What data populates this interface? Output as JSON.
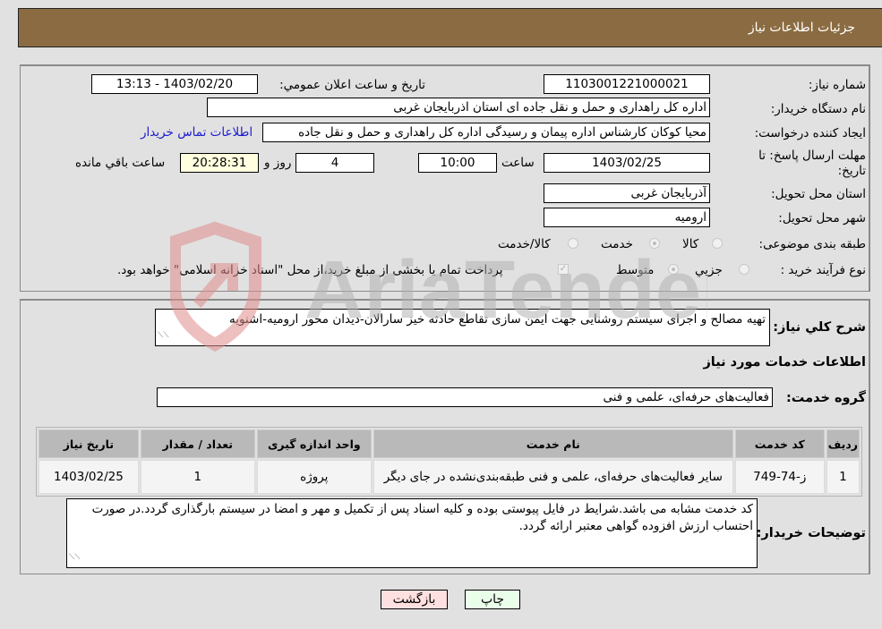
{
  "header": {
    "title": "جزئيات اطلاعات نياز"
  },
  "details": {
    "need_number_label": "شماره نیاز:",
    "need_number": "1103001221000021",
    "announce_label": "تاريخ و ساعت اعلان عمومي:",
    "announce_value": "1403/02/20 - 13:13",
    "buyer_org_label": "نام دستگاه خریدار:",
    "buyer_org": "اداره کل راهداری و حمل و نقل جاده ای استان اذربایجان غربی",
    "creator_label": "ایجاد کننده درخواست:",
    "creator": "محیا کوکان کارشناس اداره پیمان و رسیدگی اداره کل راهداری و حمل و نقل جاده",
    "contact_link": "اطلاعات تماس خریدار",
    "deadline_label": "مهلت ارسال پاسخ: تا تاریخ:",
    "deadline_date": "1403/02/25",
    "time_label": "ساعت",
    "deadline_time": "10:00",
    "days_value": "4",
    "days_label": "روز و",
    "remaining_time": "20:28:31",
    "remaining_label": "ساعت باقي مانده",
    "province_label": "استان محل تحویل:",
    "province": "آذربایجان غربی",
    "city_label": "شهر محل تحویل:",
    "city": "ارومیه",
    "category_label": "طبقه بندی موضوعی:",
    "category_options": [
      {
        "label": "کالا",
        "selected": false
      },
      {
        "label": "خدمت",
        "selected": true
      },
      {
        "label": "کالا/خدمت",
        "selected": false
      }
    ],
    "process_label": "نوع فرآیند خرید :",
    "process_options": [
      {
        "label": "جزيي",
        "selected": false
      },
      {
        "label": "متوسط",
        "selected": true
      }
    ],
    "treasury_note": "پرداخت تمام یا بخشی از مبلغ خرید،از محل \"اسناد خزانه اسلامی\" خواهد بود."
  },
  "need": {
    "description_label": "شرح كلي نياز:",
    "description": "تهیه مصالح و اجرای سیستم روشنایی جهت ایمن سازی تقاطع حادثه خیز سارالان-دیدان محور ارومیه-اشنویه",
    "services_title": "اطلاعات خدمات مورد نياز",
    "group_label": "گروه خدمت:",
    "group_value": "فعالیت‌های حرفه‌ای، علمی و فنی"
  },
  "table": {
    "headers": [
      "ردیف",
      "کد خدمت",
      "نام خدمت",
      "واحد اندازه گیری",
      "تعداد / مقدار",
      "تاریخ نیاز"
    ],
    "rows": [
      [
        "1",
        "ز-74-749",
        "سایر فعالیت‌های حرفه‌ای، علمی و فنی طبقه‌بندی‌نشده در جای دیگر",
        "پروژه",
        "1",
        "1403/02/25"
      ]
    ]
  },
  "buyer_notes": {
    "label": "توضيحات خريدار:",
    "text": "کد خدمت مشابه می باشد.شرایط در فایل پیوستی بوده و کلیه اسناد پس از تکمیل و مهر و امضا در سیستم بارگذاری گردد.در صورت احتساب ارزش افزوده گواهی معتبر ارائه گردد."
  },
  "buttons": {
    "print": "چاپ",
    "back": "بازگشت"
  },
  "watermark": {
    "text": "AriaTender.neT"
  },
  "colors": {
    "header_bg": "#8b6c42",
    "print_bg": "#eaffea",
    "back_bg": "#ffe0e0",
    "link": "#1a1ad0"
  }
}
